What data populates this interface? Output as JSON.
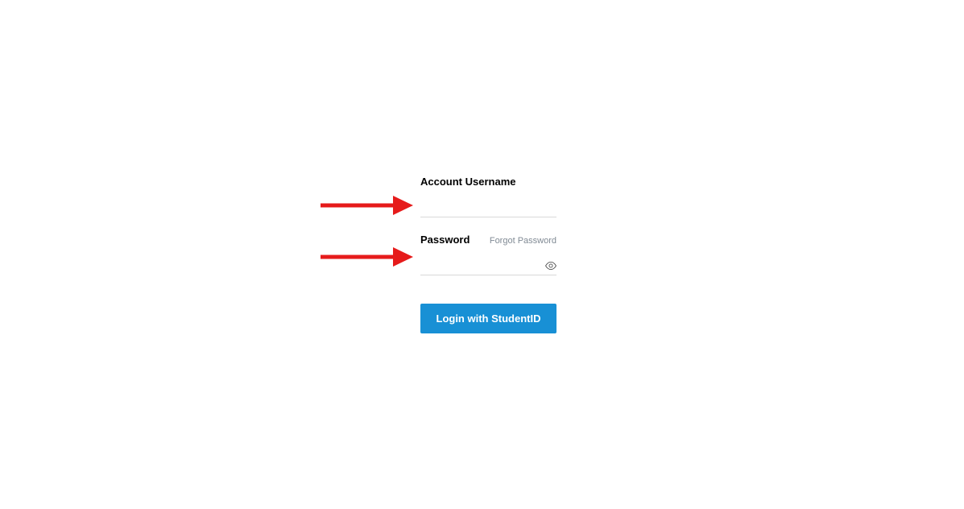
{
  "form": {
    "username_label": "Account Username",
    "username_value": "",
    "password_label": "Password",
    "password_value": "",
    "forgot_link": "Forgot Password",
    "login_button": "Login with StudentID"
  }
}
